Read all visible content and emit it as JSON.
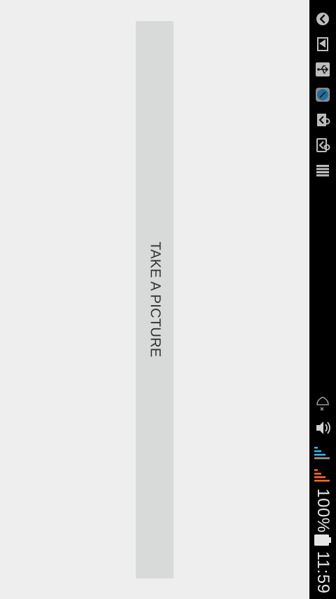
{
  "main": {
    "take_picture_label": "TAKE A PICTURE"
  },
  "status_bar": {
    "top_icons": [
      "navigation-back-icon",
      "sd-card-icon",
      "usb-icon",
      "compass-app-icon",
      "apk-install-icon",
      "apk-install-alt-icon",
      "storage-stack-icon"
    ],
    "bottom_icons": [
      "notifications-muted-icon",
      "vibrate-icon",
      "signal-bars-icon",
      "data-signal-bars-icon",
      "battery-icon"
    ],
    "battery_percent": "100%",
    "time": "11:59"
  },
  "colors": {
    "background": "#eeeeee",
    "button": "#d8d9d9",
    "button_text": "#333333",
    "status_bar": "#000000",
    "signal_blue": "#33b5e5",
    "signal_orange": "#ff6a1a"
  }
}
